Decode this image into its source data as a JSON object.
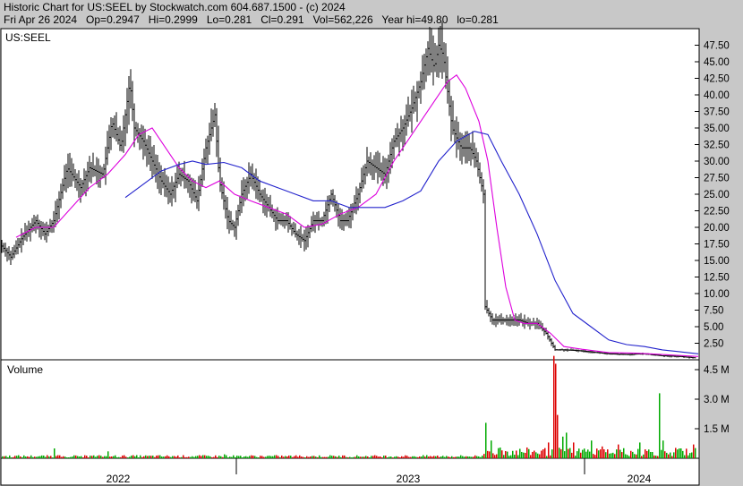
{
  "header": {
    "line1": "Historic Chart for US:SEEL by Stockwatch.com 604.687.1500 - (c) 2024",
    "line2": "Fri Apr 26 2024   Op=0.2947   Hi=0.2999   Lo=0.281   Cl=0.291   Vol=562,226   Year hi=49.80   lo=0.281"
  },
  "chart_data": [
    {
      "type": "line",
      "subtype": "ohlc-bars",
      "title": "US:SEEL",
      "x_axis": {
        "years": [
          "2022",
          "2023",
          "2024"
        ],
        "range": [
          "2021-11",
          "2024-04"
        ]
      },
      "y_axis": {
        "ticks": [
          "47.50",
          "45.00",
          "42.50",
          "40.00",
          "37.50",
          "35.00",
          "32.50",
          "30.00",
          "27.50",
          "25.00",
          "22.50",
          "20.00",
          "17.50",
          "15.00",
          "12.50",
          "10.00",
          "7.50",
          "5.00",
          "2.50"
        ],
        "range": [
          0,
          50
        ]
      },
      "series": [
        {
          "role": "price-range",
          "color": "#000000",
          "anchors": [
            [
              0,
              17.5
            ],
            [
              12,
              15.5
            ],
            [
              25,
              18.5
            ],
            [
              40,
              21
            ],
            [
              50,
              19
            ],
            [
              60,
              21
            ],
            [
              75,
              29
            ],
            [
              90,
              26
            ],
            [
              100,
              29
            ],
            [
              115,
              28
            ],
            [
              125,
              36
            ],
            [
              135,
              32
            ],
            [
              145,
              42
            ],
            [
              150,
              35
            ],
            [
              160,
              33
            ],
            [
              170,
              30
            ],
            [
              180,
              27
            ],
            [
              190,
              25
            ],
            [
              200,
              28
            ],
            [
              210,
              27
            ],
            [
              220,
              24
            ],
            [
              230,
              32
            ],
            [
              240,
              37
            ],
            [
              245,
              27
            ],
            [
              255,
              21
            ],
            [
              262,
              20
            ],
            [
              270,
              25
            ],
            [
              280,
              28
            ],
            [
              290,
              25
            ],
            [
              300,
              23
            ],
            [
              310,
              21
            ],
            [
              320,
              21
            ],
            [
              330,
              19
            ],
            [
              340,
              18
            ],
            [
              350,
              21
            ],
            [
              360,
              21
            ],
            [
              370,
              25
            ],
            [
              380,
              21
            ],
            [
              388,
              21
            ],
            [
              400,
              25
            ],
            [
              410,
              30
            ],
            [
              420,
              29
            ],
            [
              430,
              28
            ],
            [
              440,
              33
            ],
            [
              450,
              35
            ],
            [
              460,
              38
            ],
            [
              470,
              42
            ],
            [
              478,
              47
            ],
            [
              485,
              44
            ],
            [
              490,
              47.5
            ],
            [
              495,
              46
            ],
            [
              505,
              35
            ],
            [
              515,
              32
            ],
            [
              525,
              32
            ],
            [
              532,
              30
            ],
            [
              540,
              25
            ],
            [
              542,
              8
            ],
            [
              550,
              6
            ],
            [
              560,
              6
            ],
            [
              570,
              6
            ],
            [
              580,
              6
            ],
            [
              590,
              5.5
            ],
            [
              600,
              5.5
            ],
            [
              610,
              4
            ],
            [
              620,
              1.5
            ],
            [
              630,
              1.5
            ],
            [
              645,
              1.4
            ],
            [
              660,
              1.2
            ],
            [
              680,
              0.9
            ],
            [
              700,
              0.8
            ],
            [
              720,
              0.9
            ],
            [
              740,
              0.6
            ],
            [
              760,
              0.5
            ],
            [
              775,
              0.3
            ]
          ]
        },
        {
          "role": "moving-average-short",
          "color": "#dd00dd",
          "points": [
            [
              18,
              18.5
            ],
            [
              40,
              20
            ],
            [
              60,
              20
            ],
            [
              80,
              23
            ],
            [
              100,
              26
            ],
            [
              120,
              28
            ],
            [
              140,
              31
            ],
            [
              155,
              34
            ],
            [
              170,
              35
            ],
            [
              185,
              32
            ],
            [
              200,
              29
            ],
            [
              215,
              27
            ],
            [
              230,
              26
            ],
            [
              245,
              27
            ],
            [
              262,
              25
            ],
            [
              280,
              24
            ],
            [
              300,
              23
            ],
            [
              320,
              22
            ],
            [
              340,
              20
            ],
            [
              360,
              20.5
            ],
            [
              380,
              22
            ],
            [
              400,
              23
            ],
            [
              420,
              25
            ],
            [
              440,
              30
            ],
            [
              460,
              34
            ],
            [
              480,
              38
            ],
            [
              500,
              42
            ],
            [
              510,
              43
            ],
            [
              520,
              41
            ],
            [
              535,
              36
            ],
            [
              545,
              30
            ],
            [
              555,
              20
            ],
            [
              565,
              11
            ],
            [
              575,
              6
            ],
            [
              585,
              5.5
            ],
            [
              600,
              5.5
            ],
            [
              615,
              4
            ],
            [
              630,
              2
            ],
            [
              650,
              1.6
            ],
            [
              680,
              1.1
            ],
            [
              710,
              1
            ],
            [
              740,
              0.8
            ],
            [
              780,
              0.5
            ]
          ]
        },
        {
          "role": "moving-average-long",
          "color": "#2222cc",
          "points": [
            [
              140,
              24.5
            ],
            [
              160,
              26.5
            ],
            [
              180,
              28.5
            ],
            [
              200,
              29.5
            ],
            [
              215,
              30
            ],
            [
              230,
              29.5
            ],
            [
              250,
              29.8
            ],
            [
              270,
              29
            ],
            [
              290,
              27
            ],
            [
              310,
              26
            ],
            [
              330,
              25
            ],
            [
              350,
              24
            ],
            [
              370,
              24
            ],
            [
              390,
              23
            ],
            [
              410,
              23
            ],
            [
              430,
              23
            ],
            [
              450,
              24
            ],
            [
              470,
              25.5
            ],
            [
              490,
              30
            ],
            [
              510,
              33
            ],
            [
              530,
              34.5
            ],
            [
              545,
              34
            ],
            [
              560,
              30
            ],
            [
              580,
              25
            ],
            [
              600,
              19
            ],
            [
              620,
              12
            ],
            [
              640,
              7
            ],
            [
              660,
              5
            ],
            [
              680,
              3
            ],
            [
              700,
              2.3
            ],
            [
              720,
              2
            ],
            [
              740,
              1.5
            ],
            [
              760,
              1.2
            ],
            [
              780,
              0.9
            ]
          ]
        }
      ]
    },
    {
      "type": "bar",
      "title": "Volume",
      "y_axis": {
        "ticks": [
          "4.5 M",
          "3.0 M",
          "1.5 M"
        ],
        "range": [
          0,
          5
        ]
      },
      "colors": {
        "up": "#00aa00",
        "down": "#dd0000"
      },
      "spikes": [
        [
          60,
          0.5
        ],
        [
          120,
          0.35
        ],
        [
          250,
          0.2
        ],
        [
          542,
          1.8
        ],
        [
          548,
          0.9
        ],
        [
          555,
          0.6
        ],
        [
          560,
          0.4
        ],
        [
          612,
          0.8
        ],
        [
          615,
          3.2
        ],
        [
          618,
          5.2
        ],
        [
          620,
          4.8
        ],
        [
          622,
          2.2
        ],
        [
          625,
          1.5
        ],
        [
          628,
          1.1
        ],
        [
          632,
          1.3
        ],
        [
          640,
          0.8
        ],
        [
          660,
          0.9
        ],
        [
          672,
          0.6
        ],
        [
          690,
          0.7
        ],
        [
          714,
          0.8
        ],
        [
          736,
          3.3
        ],
        [
          740,
          0.9
        ],
        [
          760,
          0.5
        ],
        [
          774,
          0.7
        ]
      ]
    }
  ]
}
